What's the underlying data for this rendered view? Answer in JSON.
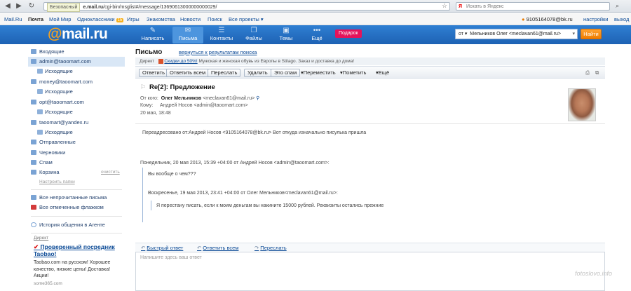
{
  "browser": {
    "back_icon": "back-arrow-icon",
    "secure_label": "Безопасный",
    "url_host": "e.mail.ru",
    "url_path": "/cgi-bin/msglist#/message/13690613000000000029/",
    "search_placeholder": "Искать в Яндекс"
  },
  "portal": {
    "links": [
      "Mail.Ru",
      "Почта",
      "Мой Мир",
      "Одноклассники",
      "Игры",
      "Знакомства",
      "Новости",
      "Поиск",
      "Все проекты ▾"
    ],
    "ok_badge": "15",
    "user_email": "9105164078@bk.ru",
    "settings": "настройки",
    "logout": "выход"
  },
  "header": {
    "logo_at": "@",
    "logo_text": "mail.ru",
    "buttons": [
      {
        "label": "Написать",
        "icon": "pencil-icon"
      },
      {
        "label": "Письма",
        "icon": "envelope-icon"
      },
      {
        "label": "Контакты",
        "icon": "contacts-icon"
      },
      {
        "label": "Файлы",
        "icon": "files-icon"
      },
      {
        "label": "Темы",
        "icon": "themes-icon"
      },
      {
        "label": "Ещё",
        "icon": "more-icon"
      }
    ],
    "gift": "Подарок",
    "from_label": "от ▾",
    "from_value": "Мельников Олег <meclavan61@mail.ru>",
    "find_button": "Найти"
  },
  "sidebar": {
    "folders": [
      {
        "label": "Входящие"
      },
      {
        "label": "admin@taoomart.com"
      },
      {
        "label": "Исходящие"
      },
      {
        "label": "money@taoomart.com"
      },
      {
        "label": "Исходящие"
      },
      {
        "label": "opt@taoomart.com"
      },
      {
        "label": "Исходящие"
      },
      {
        "label": "taoomart@yandex.ru"
      },
      {
        "label": "Исходящие"
      },
      {
        "label": "Отправленные"
      },
      {
        "label": "Черновики"
      },
      {
        "label": "Спам"
      },
      {
        "label": "Корзина"
      }
    ],
    "clear_trash": "очистить",
    "configure_folders": "Настроить папки",
    "all_unread": "Все непрочитанные письма",
    "all_flagged": "Все отмеченные флажком",
    "agent_history": "История общения в Агенте",
    "ad_header": "Директ",
    "ad_title": "Проверенный посредник Taobao!",
    "ad_text": "Taobao.com на русском! Хорошее качество, низкие цены! Доставка! Акции!",
    "ad_domain": "some365.com"
  },
  "message": {
    "page_title": "Письмо",
    "back_link": "вернуться к результатам поиска",
    "direct_label": "Директ",
    "direct_link": "Скидки до 50%!",
    "direct_text": "Мужская и женская обувь из Европы в Stilago. Заказ и доставка до дома!",
    "toolbar_buttons": [
      "Ответить",
      "Ответить всем",
      "Переслать",
      "Удалить",
      "Это спам"
    ],
    "toolbar_dropdowns": [
      "Переместить",
      "Пометить",
      "Ещё"
    ],
    "subject": "Re[2]: Предложение",
    "from_label": "От кого:",
    "from_name": "Олег Мельников",
    "from_email": "<meclavan61@mail.ru>",
    "to_label": "Кому:",
    "to_value": "Андрей Носов <admin@taoomart.com>",
    "date": "20 мая, 18:48",
    "body": {
      "forwarded": "Переадресовано от:Андрей Носов <9105164078@bk.ru> Вот откуда изначально писулька пришла",
      "quote_header_1": "Понедельник, 20 мая 2013, 15:39 +04:00 от Андрей Носов <admin@taoomart.com>:",
      "quote_text_1": "Вы вообще о чем???",
      "quote_header_2": "Воскресенье, 19 мая 2013, 23:41 +04:00 от Олег Мельников<meclavan61@mail.ru>:",
      "quote_text_2": "Я перестану писать, если к моим деньгам вы накините 15000 рублей. Реквизиты остались прежние"
    },
    "reply_links": [
      "Быстрый ответ",
      "Ответить всем",
      "Переслать"
    ],
    "reply_placeholder": "Напишите здесь ваш ответ"
  },
  "watermark": "fotoslovo.info"
}
